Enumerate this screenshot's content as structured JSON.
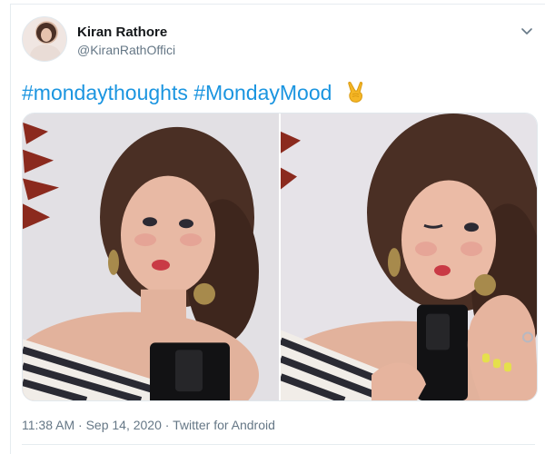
{
  "tweet": {
    "author": {
      "display_name": "Kiran Rathore",
      "handle": "@KiranRathOffici"
    },
    "text": {
      "hashtags": [
        "#mondaythoughts",
        "#MondayMood"
      ],
      "emoji": "victory-hand-emoji"
    },
    "media": [
      {
        "name": "selfie-photo-1"
      },
      {
        "name": "selfie-photo-2-winking"
      }
    ],
    "meta": {
      "time": "11:38 AM",
      "separator": " · ",
      "date": "Sep 14, 2020",
      "source": "Twitter for Android"
    }
  },
  "colors": {
    "link": "#1b95e0",
    "secondary_text": "#657786",
    "border": "#e6ecf0"
  },
  "icons": [
    "chevron-down-icon",
    "victory-hand-emoji"
  ]
}
